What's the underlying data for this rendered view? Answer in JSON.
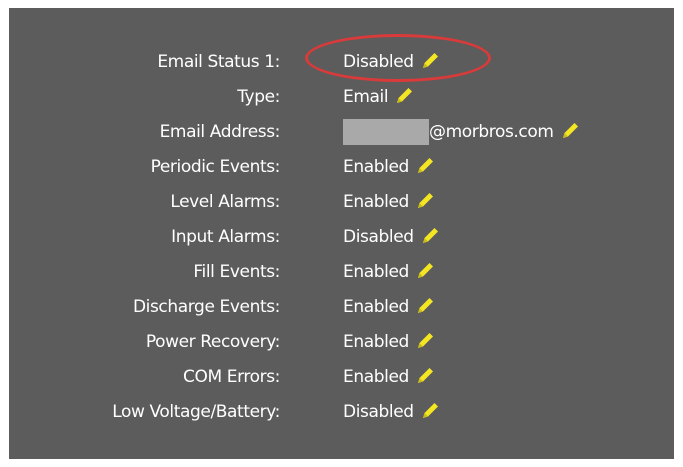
{
  "fields": [
    {
      "label": "Email Status 1:",
      "value": "Disabled"
    },
    {
      "label": "Type:",
      "value": "Email"
    },
    {
      "label": "Email Address:",
      "value": "@morbros.com",
      "redacted_prefix": true
    },
    {
      "label": "Periodic Events:",
      "value": "Enabled"
    },
    {
      "label": "Level Alarms:",
      "value": "Enabled"
    },
    {
      "label": "Input Alarms:",
      "value": "Disabled"
    },
    {
      "label": "Fill Events:",
      "value": "Enabled"
    },
    {
      "label": "Discharge Events:",
      "value": "Enabled"
    },
    {
      "label": "Power Recovery:",
      "value": "Enabled"
    },
    {
      "label": "COM Errors:",
      "value": "Enabled"
    },
    {
      "label": "Low Voltage/Battery:",
      "value": "Disabled"
    }
  ],
  "icons": {
    "edit": "pencil-icon"
  },
  "colors": {
    "panel_background": "#5c5c5c",
    "text": "#ffffff",
    "pencil": "#f5e623",
    "highlight": "#d93a3a",
    "redaction": "#a9a9a9"
  }
}
